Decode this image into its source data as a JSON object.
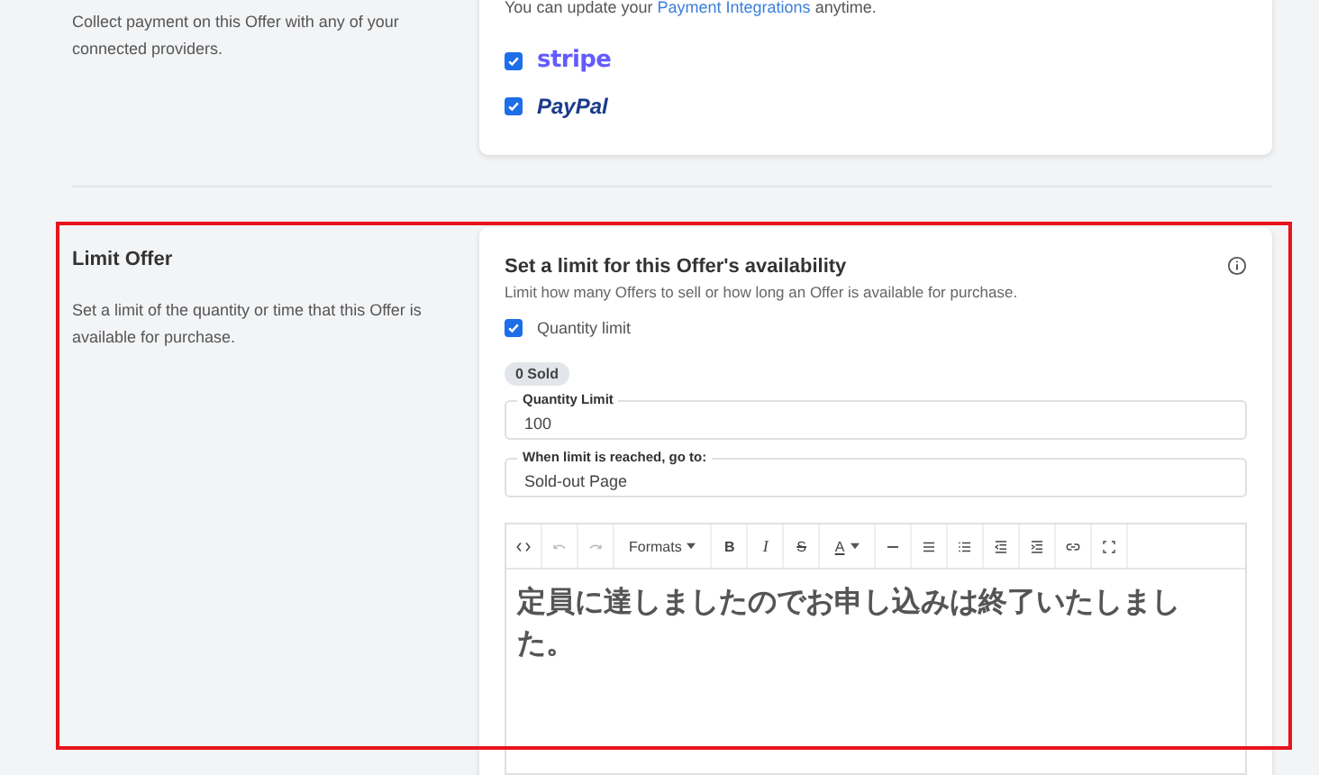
{
  "payments": {
    "description": "Collect payment on this Offer with any of your connected providers.",
    "note_before": "You can update your",
    "note_link": "Payment Integrations",
    "note_after": "anytime.",
    "providers": [
      {
        "kind": "stripe",
        "label": "stripe",
        "checked": true
      },
      {
        "kind": "paypal",
        "label": "PayPal",
        "checked": true
      }
    ]
  },
  "limit_offer": {
    "heading": "Limit Offer",
    "description": "Set a limit of the quantity or time that this Offer is available for purchase.",
    "card_title": "Set a limit for this Offer's availability",
    "card_subtitle": "Limit how many Offers to sell or how long an Offer is available for purchase.",
    "quantity_limit": {
      "label": "Quantity limit",
      "checked": true
    },
    "sold_badge": "0 Sold",
    "fields": [
      {
        "label": "Quantity Limit",
        "value": "100"
      },
      {
        "label": "When limit is reached, go to:",
        "value": "Sold-out Page"
      }
    ],
    "editor": {
      "toolbar": [
        {
          "kind": "code"
        },
        {
          "kind": "undo"
        },
        {
          "kind": "redo"
        },
        {
          "kind": "dropdown",
          "label": "Formats"
        },
        {
          "kind": "bold",
          "label": "B"
        },
        {
          "kind": "italic",
          "label": "I"
        },
        {
          "kind": "strike",
          "label": "S"
        },
        {
          "kind": "color",
          "label": "A"
        },
        {
          "kind": "rule"
        },
        {
          "kind": "bullets"
        },
        {
          "kind": "numbers"
        },
        {
          "kind": "outdent"
        },
        {
          "kind": "indent"
        },
        {
          "kind": "link"
        },
        {
          "kind": "fullscreen"
        }
      ],
      "content": "定員に達しましたのでお申し込みは終了いたしました。"
    }
  },
  "highlight": true
}
